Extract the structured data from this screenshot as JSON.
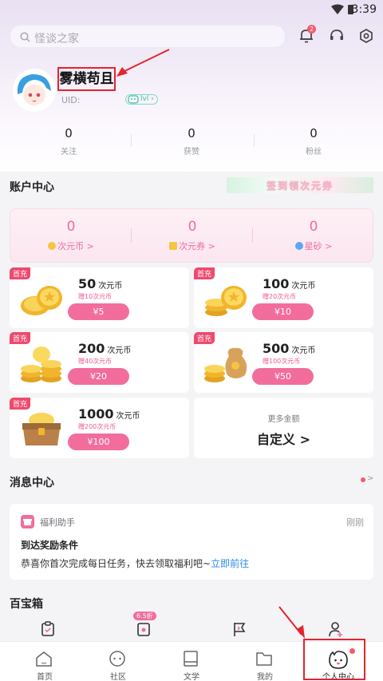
{
  "status_bar": {
    "time": "3:39"
  },
  "search": {
    "placeholder": "怪谈之家"
  },
  "notification_count": "2",
  "user": {
    "name": "雾横苟且",
    "uid_label": "UID:",
    "level": "lvl"
  },
  "stats": [
    {
      "value": "0",
      "label": "关注"
    },
    {
      "value": "0",
      "label": "获赞"
    },
    {
      "value": "0",
      "label": "粉丝"
    }
  ],
  "account": {
    "title": "账户中心",
    "banner_text": "签到领次元券",
    "balances": [
      {
        "value": "0",
        "label": "次元币 >"
      },
      {
        "value": "0",
        "label": "次元券 >"
      },
      {
        "value": "0",
        "label": "星砂 >"
      }
    ]
  },
  "packages": [
    {
      "tag": "首充",
      "amount": "50",
      "unit": "次元币",
      "bonus": "赠10次元币",
      "price": "¥5"
    },
    {
      "tag": "首充",
      "amount": "100",
      "unit": "次元币",
      "bonus": "赠20次元币",
      "price": "¥10"
    },
    {
      "tag": "首充",
      "amount": "200",
      "unit": "次元币",
      "bonus": "赠40次元币",
      "price": "¥20"
    },
    {
      "tag": "首充",
      "amount": "500",
      "unit": "次元币",
      "bonus": "赠100次元币",
      "price": "¥50"
    },
    {
      "tag": "首充",
      "amount": "1000",
      "unit": "次元币",
      "bonus": "赠200次元币",
      "price": "¥100"
    }
  ],
  "custom_amount": {
    "sub": "更多金额",
    "label": "自定义 >"
  },
  "messages": {
    "title": "消息中心",
    "chevron": ">",
    "item": {
      "from": "福利助手",
      "time": "刚刚",
      "title": "到达奖励条件",
      "body": "恭喜你首次完成每日任务，快去领取福利吧~",
      "link": "立即前往"
    }
  },
  "treasure": {
    "title": "百宝箱",
    "badge": "6.5折"
  },
  "tabs": [
    {
      "label": "首页"
    },
    {
      "label": "社区"
    },
    {
      "label": "文学"
    },
    {
      "label": "我的"
    },
    {
      "label": "个人中心"
    }
  ],
  "colors": {
    "accent": "#f26d9c",
    "annotation": "#e4242e",
    "link": "#2d8be8"
  }
}
